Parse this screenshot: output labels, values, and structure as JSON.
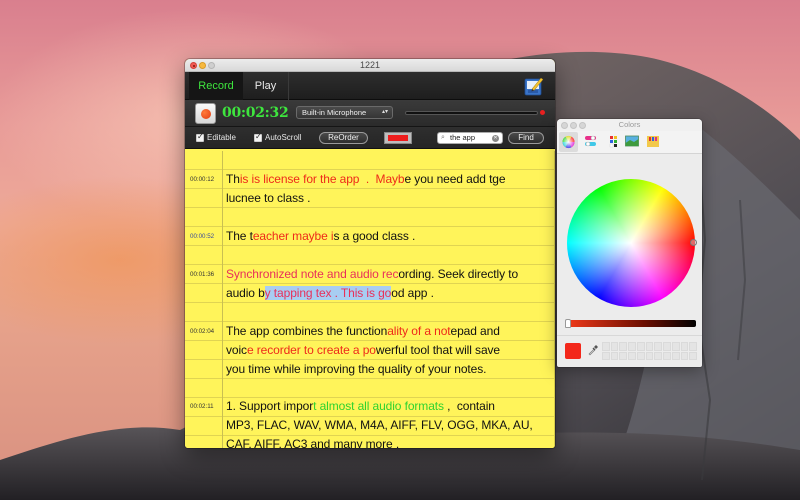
{
  "window": {
    "title": "1221"
  },
  "tabs": [
    {
      "label": "Record",
      "active": true
    },
    {
      "label": "Play",
      "active": false
    }
  ],
  "toolbar": {
    "timer": "00:02:32",
    "input_device": "Built-in Microphone",
    "level_percent": 0
  },
  "options": {
    "editable_label": "Editable",
    "editable_checked": true,
    "autoscroll_label": "AutoScroll",
    "autoscroll_checked": true,
    "reorder_label": "ReOrder",
    "text_color": "#ee1c1c",
    "search_value": "the app",
    "find_label": "Find"
  },
  "notes": [
    {
      "timestamp": "00:00:12",
      "segments": [
        {
          "text": "Th",
          "style": "normal"
        },
        {
          "text": "is is license for the app  .  Mayb",
          "style": "red"
        },
        {
          "text": "e you need add tge\nlucnee to class .",
          "style": "normal"
        }
      ]
    },
    {
      "timestamp": "00:00:52",
      "timestamp_style": "blue",
      "segments": [
        {
          "text": "The t",
          "style": "normal"
        },
        {
          "text": "eacher maybe i",
          "style": "red"
        },
        {
          "text": "s a good class .",
          "style": "normal"
        }
      ]
    },
    {
      "timestamp": "00:01:36",
      "segments": [
        {
          "text": "Synchronized note and audio rec",
          "style": "pink"
        },
        {
          "text": "ording. Seek directly to\naudio b",
          "style": "normal"
        },
        {
          "text": "y tapping tex . This is go",
          "style": "pink-selected"
        },
        {
          "text": "od app .",
          "style": "normal"
        }
      ]
    },
    {
      "timestamp": "00:02:04",
      "segments": [
        {
          "text": "The app combines the function",
          "style": "normal"
        },
        {
          "text": "ality of a not",
          "style": "red"
        },
        {
          "text": "epad and\nvoic",
          "style": "normal"
        },
        {
          "text": "e recorder to create a po",
          "style": "red"
        },
        {
          "text": "werful tool that will save\nyou time while improving the quality of your notes.",
          "style": "normal"
        }
      ]
    },
    {
      "timestamp": "00:02:11",
      "segments": [
        {
          "text": "1. Support impor",
          "style": "normal"
        },
        {
          "text": "t almost all audio formats",
          "style": "green"
        },
        {
          "text": " ,  contain\nMP3, FLAC, WAV, WMA, M4A, AIFF, FLV, OGG, MKA, AU,\nCAF, AIFF, AC3 and many more .",
          "style": "normal"
        }
      ]
    }
  ],
  "colors_panel": {
    "title": "Colors",
    "modes": [
      "color-wheel",
      "color-sliders",
      "color-palettes",
      "image-palettes",
      "crayons"
    ],
    "active_mode": "color-wheel",
    "current_color": "#f3271a",
    "brightness_percent": 100
  }
}
